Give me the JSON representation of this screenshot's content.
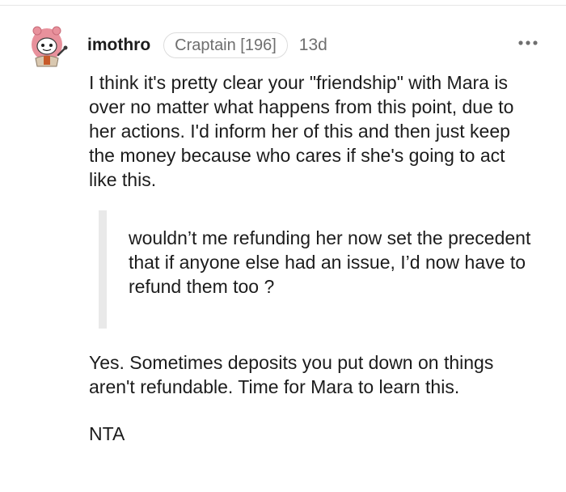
{
  "comment": {
    "username": "imothro",
    "flair": "Craptain [196]",
    "age": "13d",
    "more_icon": "more-horizontal-icon",
    "avatar_icon": "snoo-avatar-icon",
    "paragraphs": [
      "I think it's pretty clear your \"friendship\" with Mara is over no matter what happens from this point, due to her actions. I'd inform her of this and then just keep the money because who cares if she's going to act like this.",
      "Yes. Sometimes deposits you put down on things aren't refundable. Time for Mara to learn this.",
      "NTA"
    ],
    "quote": "wouldn’t me refunding her now set the precedent that if anyone else had an issue, I’d now have to refund them too ?"
  },
  "colors": {
    "text": "#1c1c1c",
    "meta": "#6f6f6f",
    "quote_bar": "#e9e9e9",
    "avatar_pink": "#e8919c"
  }
}
